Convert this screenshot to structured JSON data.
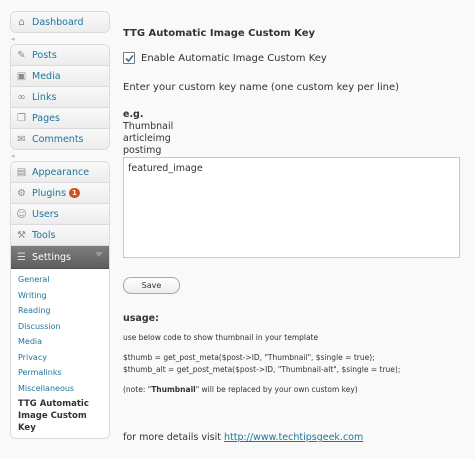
{
  "sidebar": {
    "group1": [
      {
        "label": "Dashboard",
        "icon": "dashboard-icon"
      }
    ],
    "group2": [
      {
        "label": "Posts",
        "icon": "posts-icon"
      },
      {
        "label": "Media",
        "icon": "media-icon"
      },
      {
        "label": "Links",
        "icon": "links-icon"
      },
      {
        "label": "Pages",
        "icon": "pages-icon"
      },
      {
        "label": "Comments",
        "icon": "comments-icon"
      }
    ],
    "group3": [
      {
        "label": "Appearance",
        "icon": "appearance-icon"
      },
      {
        "label": "Plugins",
        "icon": "plugins-icon",
        "badge": "1"
      },
      {
        "label": "Users",
        "icon": "users-icon"
      },
      {
        "label": "Tools",
        "icon": "tools-icon"
      }
    ],
    "settings": {
      "label": "Settings",
      "icon": "settings-icon",
      "items": [
        "General",
        "Writing",
        "Reading",
        "Discussion",
        "Media",
        "Privacy",
        "Permalinks",
        "Miscellaneous"
      ],
      "current_line1": "TTG Automatic",
      "current_line2": "Image Custom Key"
    }
  },
  "main": {
    "title": "TTG Automatic Image Custom Key",
    "enable_label": "Enable Automatic Image Custom Key",
    "enable_checked": true,
    "instruction": "Enter your custom key name (one custom key per line)",
    "eg_title": "e.g.",
    "eg_items": [
      "Thumbnail",
      "articleimg",
      "postimg"
    ],
    "textarea_value": "featured_image",
    "save_label": "Save",
    "usage_title": "usage:",
    "usage_desc": "use below code to show thumbnail in your template",
    "code_line1": "$thumb = get_post_meta($post->ID, \"Thumbnail\", $single = true);",
    "code_line2": "$thumb_alt = get_post_meta($post->ID, \"Thumbnail-alt\", $single = true);",
    "note_prefix": "(note: \"",
    "note_bold": "Thumbnail",
    "note_suffix": "\" will be replaced by your own custom key)",
    "details_prefix": "for more details visit ",
    "details_link": "http://www.techtipsgeek.com"
  },
  "colors": {
    "link": "#21759b",
    "badge": "#d54e21",
    "settings_header": "#6d6d6d"
  }
}
